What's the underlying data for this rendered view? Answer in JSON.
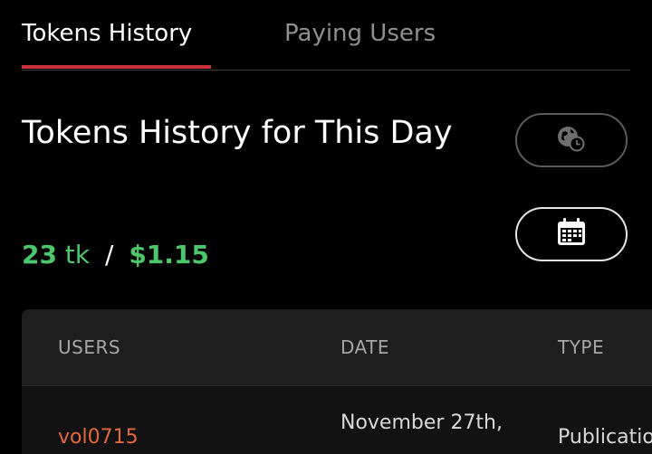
{
  "tabs": [
    {
      "label": "Tokens History",
      "active": true
    },
    {
      "label": "Paying Users",
      "active": false
    }
  ],
  "page": {
    "title": "Tokens History for This Day"
  },
  "totals": {
    "tokens_value": "23",
    "tokens_unit": "tk",
    "separator": "/",
    "dollars": "$1.15"
  },
  "buttons": {
    "timezone_icon": "globe-clock-icon",
    "calendar_icon": "calendar-icon"
  },
  "table": {
    "columns": [
      "USERS",
      "DATE",
      "TYPE"
    ],
    "rows": [
      {
        "user": "vol0715",
        "date": "November 27th,",
        "type": "Publication"
      }
    ]
  },
  "colors": {
    "accent_tab": "#c8323d",
    "positive": "#4cc76b",
    "user_link": "#e0683e"
  }
}
